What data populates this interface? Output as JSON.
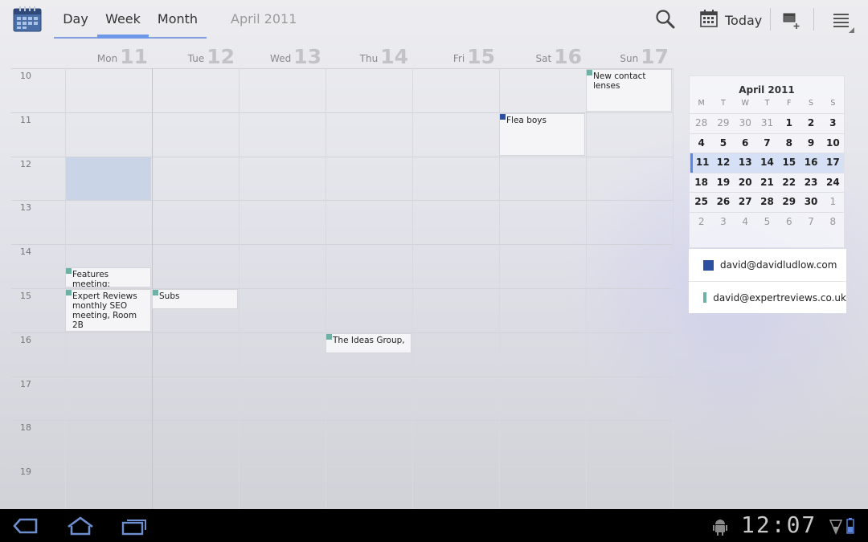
{
  "header": {
    "tabs": [
      {
        "label": "Day",
        "active": false
      },
      {
        "label": "Week",
        "active": true
      },
      {
        "label": "Month",
        "active": false
      }
    ],
    "title": "April 2011",
    "today_label": "Today"
  },
  "days": [
    {
      "name": "Mon",
      "date": "11"
    },
    {
      "name": "Tue",
      "date": "12"
    },
    {
      "name": "Wed",
      "date": "13"
    },
    {
      "name": "Thu",
      "date": "14"
    },
    {
      "name": "Fri",
      "date": "15"
    },
    {
      "name": "Sat",
      "date": "16"
    },
    {
      "name": "Sun",
      "date": "17"
    }
  ],
  "hours": [
    "10",
    "11",
    "12",
    "13",
    "14",
    "15",
    "16",
    "17",
    "18",
    "19"
  ],
  "events": [
    {
      "title": "New contact lenses",
      "day": 6,
      "start": 10,
      "end": 11,
      "account": 1
    },
    {
      "title": "Flea boys",
      "day": 5,
      "start": 11,
      "end": 12,
      "account": 0
    },
    {
      "title": "Features meeting:",
      "day": 0,
      "start": 14.5,
      "end": 15,
      "account": 1
    },
    {
      "title": "Expert Reviews monthly SEO meeting, Room 2B",
      "day": 0,
      "start": 15,
      "end": 16,
      "account": 1
    },
    {
      "title": "Subs",
      "day": 1,
      "start": 15,
      "end": 15.5,
      "account": 1
    },
    {
      "title": "The Ideas Group,",
      "day": 3,
      "start": 16,
      "end": 16.5,
      "account": 1
    }
  ],
  "mini_calendar": {
    "title": "April 2011",
    "dow": [
      "M",
      "T",
      "W",
      "T",
      "F",
      "S",
      "S"
    ],
    "weeks": [
      [
        {
          "d": "28",
          "dim": true
        },
        {
          "d": "29",
          "dim": true
        },
        {
          "d": "30",
          "dim": true
        },
        {
          "d": "31",
          "dim": true
        },
        {
          "d": "1"
        },
        {
          "d": "2"
        },
        {
          "d": "3"
        }
      ],
      [
        {
          "d": "4"
        },
        {
          "d": "5"
        },
        {
          "d": "6"
        },
        {
          "d": "7"
        },
        {
          "d": "8"
        },
        {
          "d": "9"
        },
        {
          "d": "10"
        }
      ],
      [
        {
          "d": "11"
        },
        {
          "d": "12"
        },
        {
          "d": "13"
        },
        {
          "d": "14"
        },
        {
          "d": "15"
        },
        {
          "d": "16"
        },
        {
          "d": "17"
        }
      ],
      [
        {
          "d": "18"
        },
        {
          "d": "19"
        },
        {
          "d": "20"
        },
        {
          "d": "21"
        },
        {
          "d": "22"
        },
        {
          "d": "23"
        },
        {
          "d": "24"
        }
      ],
      [
        {
          "d": "25"
        },
        {
          "d": "26"
        },
        {
          "d": "27"
        },
        {
          "d": "28"
        },
        {
          "d": "29"
        },
        {
          "d": "30"
        },
        {
          "d": "1",
          "dim": true
        }
      ],
      [
        {
          "d": "2",
          "dim": true
        },
        {
          "d": "3",
          "dim": true
        },
        {
          "d": "4",
          "dim": true
        },
        {
          "d": "5",
          "dim": true
        },
        {
          "d": "6",
          "dim": true
        },
        {
          "d": "7",
          "dim": true
        },
        {
          "d": "8",
          "dim": true
        }
      ]
    ],
    "current_week": 2
  },
  "accounts": [
    {
      "email": "david@davidludlow.com",
      "color": "#2d4fa0"
    },
    {
      "email": "david@expertreviews.co.uk",
      "color": "#6eb0a4"
    }
  ],
  "status_bar": {
    "time": "12:07"
  },
  "colors": {
    "accent": "#6f98e8",
    "account_blue": "#2d4fa0",
    "account_teal": "#6eb0a4"
  },
  "icons": [
    "calendar-app-icon",
    "search-icon",
    "today-calendar-icon",
    "new-event-icon",
    "overflow-menu-icon",
    "back-icon",
    "home-icon",
    "recent-apps-icon",
    "android-debug-icon",
    "signal-icon",
    "battery-icon"
  ]
}
